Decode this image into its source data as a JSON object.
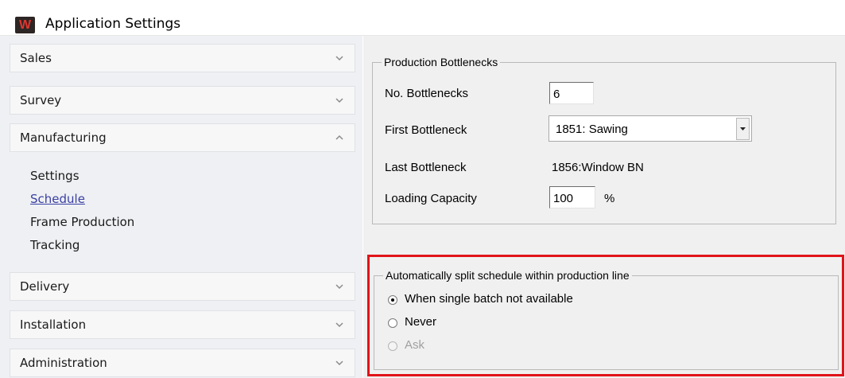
{
  "window": {
    "title": "Application Settings",
    "icon_name": "app-logo-icon",
    "icon_glyph": "W"
  },
  "sidebar": {
    "sections": [
      {
        "label": "Sales",
        "state": "collapsed"
      },
      {
        "label": "Survey",
        "state": "collapsed"
      },
      {
        "label": "Manufacturing",
        "state": "expanded"
      },
      {
        "label": "Delivery",
        "state": "collapsed"
      },
      {
        "label": "Installation",
        "state": "collapsed"
      },
      {
        "label": "Administration",
        "state": "collapsed"
      }
    ],
    "manufacturing_items": [
      {
        "label": "Settings",
        "selected": false
      },
      {
        "label": "Schedule",
        "selected": true
      },
      {
        "label": "Frame Production",
        "selected": false
      },
      {
        "label": "Tracking",
        "selected": false
      }
    ]
  },
  "bottlenecks": {
    "group_title": "Production  Bottlenecks",
    "no_bottlenecks_label": "No. Bottlenecks",
    "no_bottlenecks_value": "6",
    "first_bottleneck_label": "First Bottleneck",
    "first_bottleneck_value": "1851: Sawing",
    "last_bottleneck_label": "Last Bottleneck",
    "last_bottleneck_value": "1856:Window BN",
    "loading_capacity_label": "Loading Capacity",
    "loading_capacity_value": "100",
    "loading_capacity_unit": "%"
  },
  "split_schedule": {
    "group_title": "Automatically split schedule within production line",
    "options": [
      {
        "label": "When single batch not available",
        "checked": true,
        "enabled": true
      },
      {
        "label": "Never",
        "checked": false,
        "enabled": true
      },
      {
        "label": "Ask",
        "checked": false,
        "enabled": false
      }
    ]
  },
  "colors": {
    "highlight_border": "#e0141a",
    "link": "#3a3fa3",
    "sidebar_bg": "#eef0f3",
    "panel_bg": "#f0f0f0"
  }
}
